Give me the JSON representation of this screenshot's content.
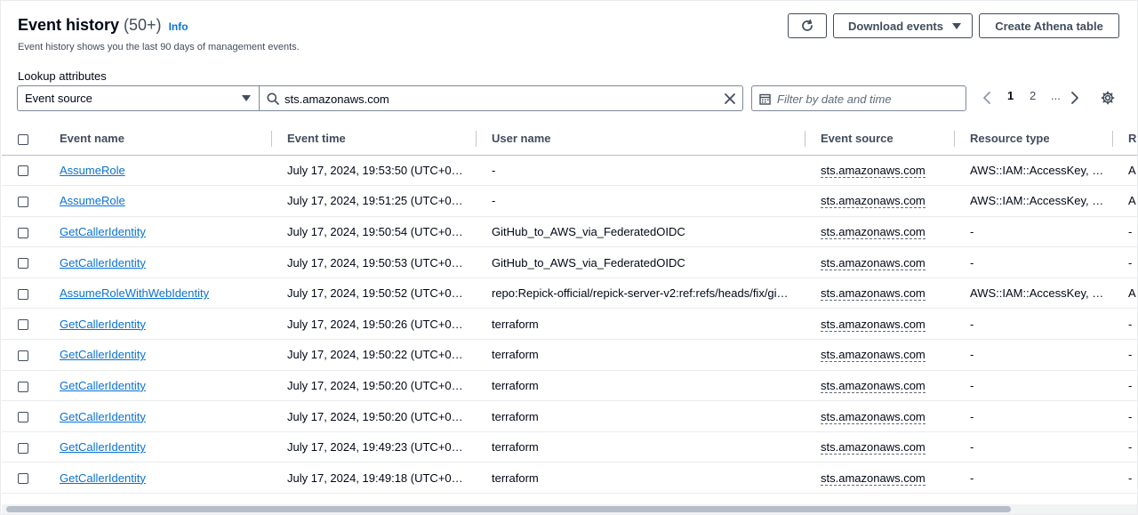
{
  "header": {
    "title": "Event history",
    "count": "(50+)",
    "info": "Info",
    "description": "Event history shows you the last 90 days of management events."
  },
  "toolbar": {
    "refresh_icon": "refresh-icon",
    "download_label": "Download events",
    "athena_label": "Create Athena table"
  },
  "lookup": {
    "label": "Lookup attributes",
    "attribute": "Event source",
    "value": "sts.amazonaws.com",
    "date_placeholder": "Filter by date and time"
  },
  "pagination": {
    "current": "1",
    "next_page": "2",
    "ellipsis": "..."
  },
  "table": {
    "columns": [
      "Event name",
      "Event time",
      "User name",
      "Event source",
      "Resource type",
      "R"
    ],
    "rows": [
      {
        "event_name": "AssumeRole",
        "event_time": "July 17, 2024, 19:53:50 (UTC+0…",
        "user_name": "-",
        "event_source": "sts.amazonaws.com",
        "resource_type": "AWS::IAM::AccessKey, …",
        "extra": "A"
      },
      {
        "event_name": "AssumeRole",
        "event_time": "July 17, 2024, 19:51:25 (UTC+0…",
        "user_name": "-",
        "event_source": "sts.amazonaws.com",
        "resource_type": "AWS::IAM::AccessKey, …",
        "extra": "A"
      },
      {
        "event_name": "GetCallerIdentity",
        "event_time": "July 17, 2024, 19:50:54 (UTC+0…",
        "user_name": "GitHub_to_AWS_via_FederatedOIDC",
        "event_source": "sts.amazonaws.com",
        "resource_type": "-",
        "extra": "-"
      },
      {
        "event_name": "GetCallerIdentity",
        "event_time": "July 17, 2024, 19:50:53 (UTC+0…",
        "user_name": "GitHub_to_AWS_via_FederatedOIDC",
        "event_source": "sts.amazonaws.com",
        "resource_type": "-",
        "extra": "-"
      },
      {
        "event_name": "AssumeRoleWithWebIdentity",
        "event_time": "July 17, 2024, 19:50:52 (UTC+0…",
        "user_name": "repo:Repick-official/repick-server-v2:ref:refs/heads/fix/gi…",
        "event_source": "sts.amazonaws.com",
        "resource_type": "AWS::IAM::AccessKey, …",
        "extra": "A"
      },
      {
        "event_name": "GetCallerIdentity",
        "event_time": "July 17, 2024, 19:50:26 (UTC+0…",
        "user_name": "terraform",
        "event_source": "sts.amazonaws.com",
        "resource_type": "-",
        "extra": "-"
      },
      {
        "event_name": "GetCallerIdentity",
        "event_time": "July 17, 2024, 19:50:22 (UTC+0…",
        "user_name": "terraform",
        "event_source": "sts.amazonaws.com",
        "resource_type": "-",
        "extra": "-"
      },
      {
        "event_name": "GetCallerIdentity",
        "event_time": "July 17, 2024, 19:50:20 (UTC+0…",
        "user_name": "terraform",
        "event_source": "sts.amazonaws.com",
        "resource_type": "-",
        "extra": "-"
      },
      {
        "event_name": "GetCallerIdentity",
        "event_time": "July 17, 2024, 19:50:20 (UTC+0…",
        "user_name": "terraform",
        "event_source": "sts.amazonaws.com",
        "resource_type": "-",
        "extra": "-"
      },
      {
        "event_name": "GetCallerIdentity",
        "event_time": "July 17, 2024, 19:49:23 (UTC+0…",
        "user_name": "terraform",
        "event_source": "sts.amazonaws.com",
        "resource_type": "-",
        "extra": "-"
      },
      {
        "event_name": "GetCallerIdentity",
        "event_time": "July 17, 2024, 19:49:18 (UTC+0…",
        "user_name": "terraform",
        "event_source": "sts.amazonaws.com",
        "resource_type": "-",
        "extra": "-"
      }
    ]
  },
  "colors": {
    "link": "#0972d3",
    "text": "#000716",
    "secondary": "#414d5c",
    "border": "#7d8998"
  }
}
